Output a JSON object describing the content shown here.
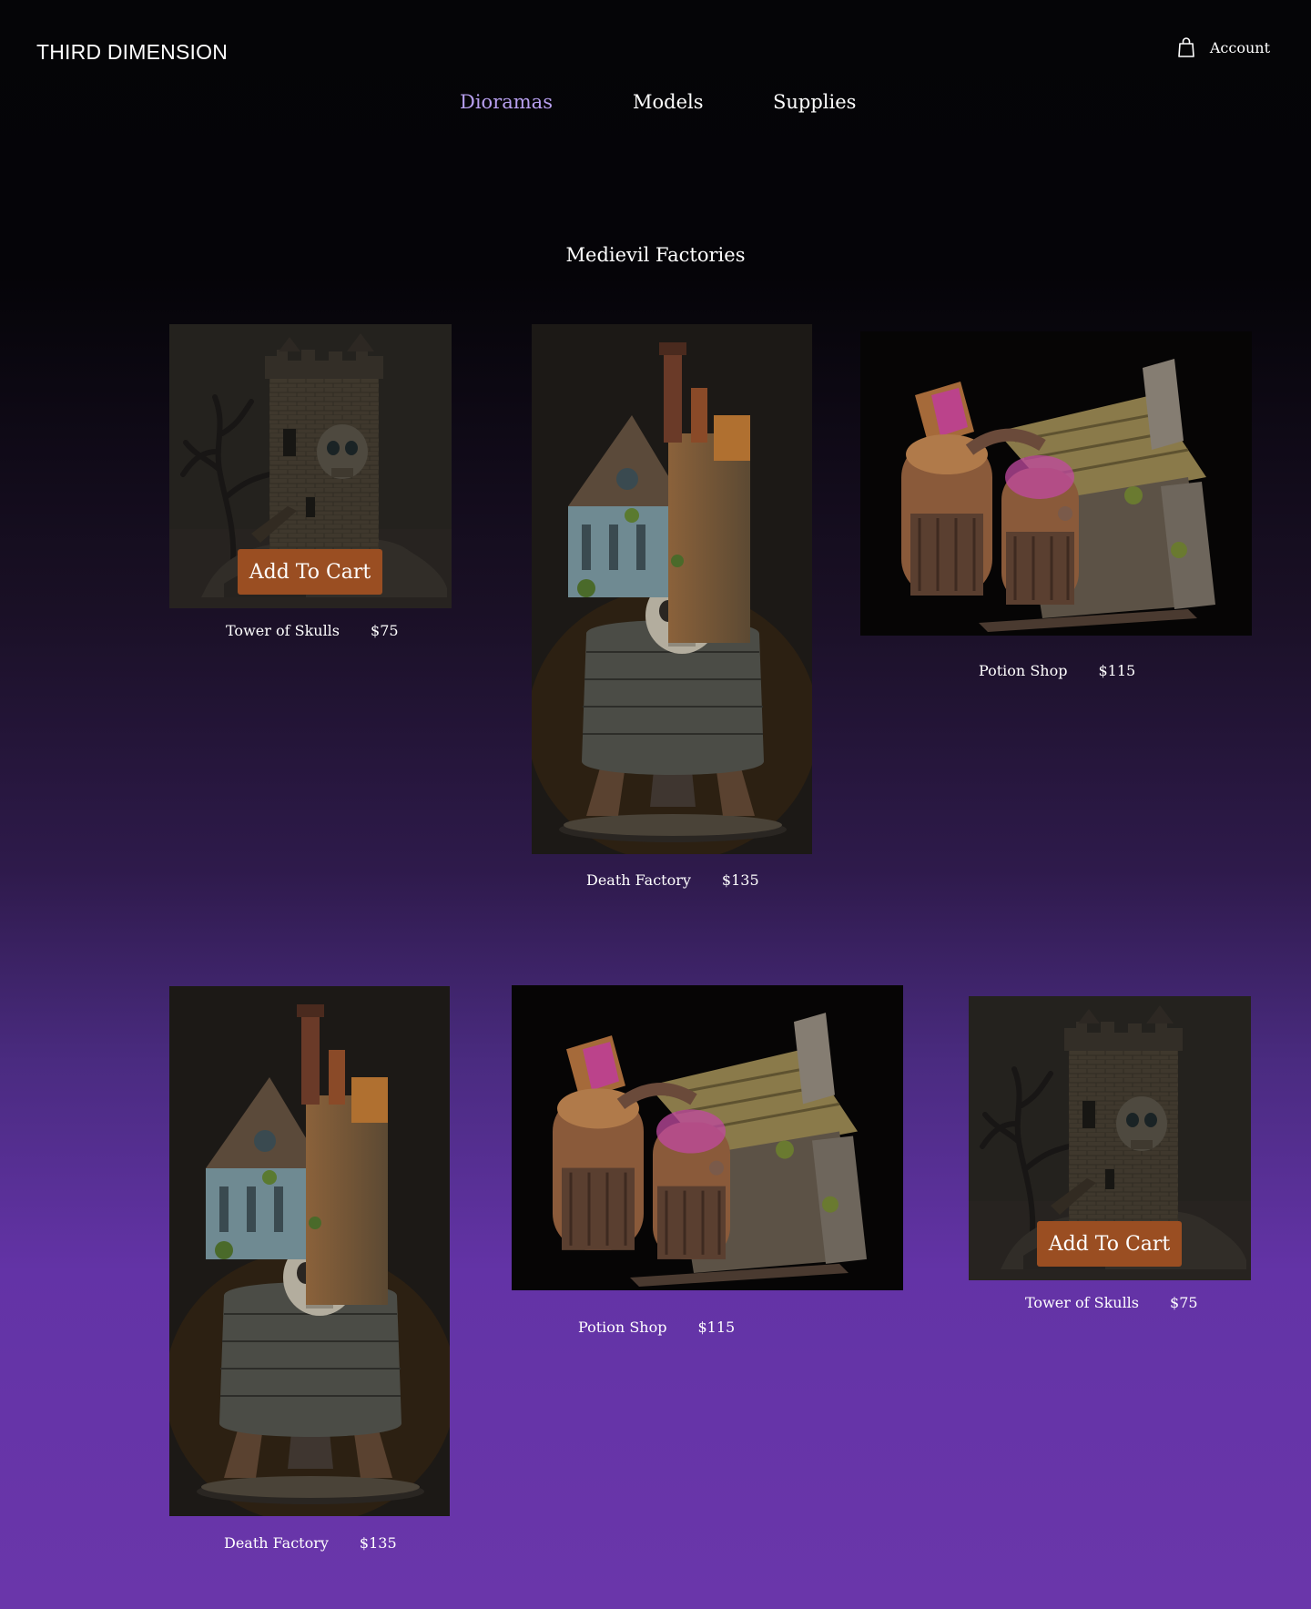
{
  "header": {
    "brand": "THIRD DIMENSION",
    "account_label": "Account",
    "nav": [
      {
        "label": "Dioramas",
        "active": true
      },
      {
        "label": "Models",
        "active": false
      },
      {
        "label": "Supplies",
        "active": false
      }
    ]
  },
  "section": {
    "title": "Medievil Factories"
  },
  "products": [
    {
      "name": "Tower of Skulls",
      "price": "$75",
      "image": "tower-of-skulls",
      "cart_label": "Add To Cart"
    },
    {
      "name": "Death Factory",
      "price": "$135",
      "image": "death-factory"
    },
    {
      "name": "Potion Shop",
      "price": "$115",
      "image": "potion-shop"
    },
    {
      "name": "Death Factory",
      "price": "$135",
      "image": "death-factory"
    },
    {
      "name": "Potion Shop",
      "price": "$115",
      "image": "potion-shop"
    },
    {
      "name": "Tower of Skulls",
      "price": "$75",
      "image": "tower-of-skulls",
      "cart_label": "Add To Cart"
    }
  ],
  "colors": {
    "accent_nav": "#b8a0f0",
    "cart_button": "#9a4e22",
    "background_top": "#050507",
    "background_bottom": "#6a36aa"
  }
}
